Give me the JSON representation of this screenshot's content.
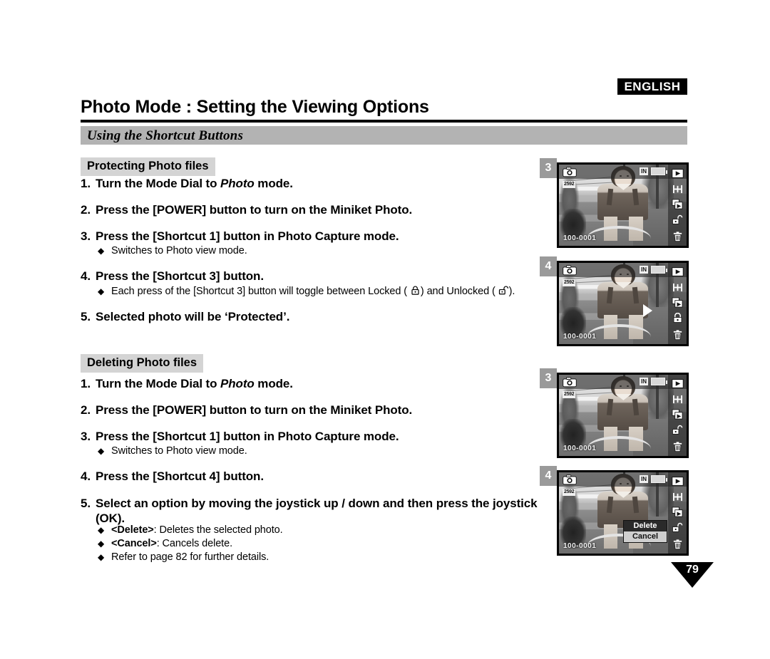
{
  "header": {
    "language_badge": "ENGLISH",
    "title": "Photo Mode : Setting the Viewing Options",
    "section_band": "Using the Shortcut Buttons"
  },
  "sections": [
    {
      "subhead": "Protecting Photo files",
      "steps": [
        {
          "num": "1.",
          "pre": "Turn the Mode Dial to ",
          "italic": "Photo",
          "post": " mode."
        },
        {
          "num": "2.",
          "pre": "Press the [POWER] button to turn on the Miniket Photo.",
          "italic": "",
          "post": ""
        },
        {
          "num": "3.",
          "pre": "Press the [Shortcut 1] button in Photo Capture mode.",
          "italic": "",
          "post": ""
        },
        {
          "num": "4.",
          "pre": "Press the [Shortcut 3] button.",
          "italic": "",
          "post": ""
        },
        {
          "num": "5.",
          "pre": "Selected photo will be ‘Protected’.",
          "italic": "",
          "post": ""
        }
      ],
      "bullets": [
        {
          "text": "Switches to Photo view mode."
        },
        {
          "text_pre": "Each press of the [Shortcut 3] button will toggle between Locked (",
          "text_mid": ") and Unlocked (",
          "text_post": ")."
        }
      ]
    },
    {
      "subhead": "Deleting Photo files",
      "steps": [
        {
          "num": "1.",
          "pre": "Turn the Mode Dial to ",
          "italic": "Photo",
          "post": " mode."
        },
        {
          "num": "2.",
          "pre": "Press the [POWER] button to turn on the Miniket Photo.",
          "italic": "",
          "post": ""
        },
        {
          "num": "3.",
          "pre": "Press the [Shortcut 1] button in Photo Capture mode.",
          "italic": "",
          "post": ""
        },
        {
          "num": "4.",
          "pre": "Press the [Shortcut 4] button.",
          "italic": "",
          "post": ""
        },
        {
          "num": "5.",
          "pre": "Select an option by moving the joystick up / down and then press the joystick (OK).",
          "italic": "",
          "post": ""
        }
      ],
      "bullets": [
        {
          "text": "Switches to Photo view mode."
        },
        {
          "bold": "<Delete>",
          "text": ": Deletes the selected photo."
        },
        {
          "bold": "<Cancel>",
          "text": ": Cancels delete."
        },
        {
          "text": "Refer to page 82 for further details."
        }
      ]
    }
  ],
  "shots": [
    {
      "badge": "3",
      "osd": {
        "mode_icon": "camera-icon",
        "resolution": "2592",
        "memory": "IN",
        "battery_icon": "battery-icon",
        "file_number": "100-0001",
        "side_icons": [
          "play-icon",
          "cut-icon",
          "copy-icon",
          "unlock-icon",
          "trash-icon"
        ],
        "lock_state": "unlocked"
      },
      "dialog": null,
      "cursor": false
    },
    {
      "badge": "4",
      "osd": {
        "mode_icon": "camera-icon",
        "resolution": "2592",
        "memory": "IN",
        "battery_icon": "battery-icon",
        "file_number": "100-0001",
        "side_icons": [
          "play-icon",
          "cut-icon",
          "copy-icon",
          "lock-icon",
          "trash-icon"
        ],
        "lock_state": "locked"
      },
      "dialog": null,
      "cursor": true
    },
    {
      "badge": "3",
      "osd": {
        "mode_icon": "camera-icon",
        "resolution": "2592",
        "memory": "IN",
        "battery_icon": "battery-icon",
        "file_number": "100-0001",
        "side_icons": [
          "play-icon",
          "cut-icon",
          "copy-icon",
          "unlock-icon",
          "trash-icon"
        ],
        "lock_state": "unlocked"
      },
      "dialog": null,
      "cursor": false
    },
    {
      "badge": "4",
      "osd": {
        "mode_icon": "camera-icon",
        "resolution": "2592",
        "memory": "IN",
        "battery_icon": "battery-icon",
        "file_number": "100-0001",
        "side_icons": [
          "play-icon",
          "cut-icon",
          "copy-icon",
          "unlock-icon",
          "trash-icon"
        ],
        "lock_state": "unlocked"
      },
      "dialog": {
        "options": [
          "Delete",
          "Cancel"
        ],
        "selected": "Delete"
      },
      "cursor": false
    }
  ],
  "footer": {
    "page_number": "79"
  },
  "colors": {
    "band_gray": "#b3b3b3",
    "subhead_gray": "#d4d4d4",
    "badge_gray": "#9a9a9a",
    "black": "#000000"
  }
}
